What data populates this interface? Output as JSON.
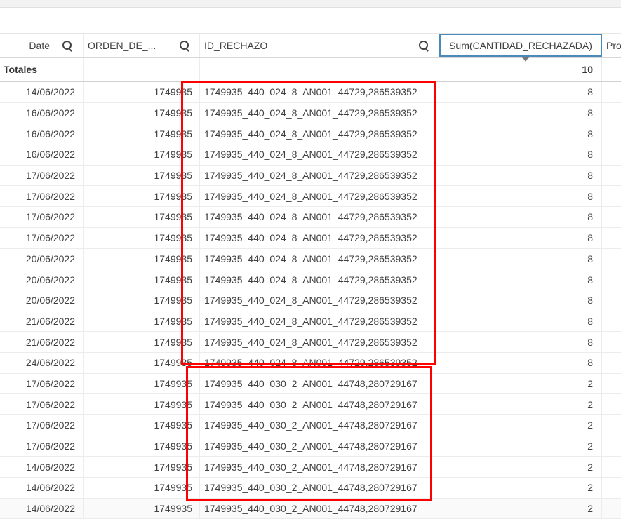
{
  "columns": {
    "date": "Date",
    "orden": "ORDEN_DE_...",
    "id": "ID_RECHAZO",
    "sum": "Sum(CANTIDAD_RECHAZADA)",
    "next": "Pro"
  },
  "totals": {
    "label": "Totales",
    "sum": "10"
  },
  "rows": [
    [
      "14/06/2022",
      "1749935",
      "1749935_440_024_8_AN001_44729,286539352",
      "8"
    ],
    [
      "16/06/2022",
      "1749935",
      "1749935_440_024_8_AN001_44729,286539352",
      "8"
    ],
    [
      "16/06/2022",
      "1749935",
      "1749935_440_024_8_AN001_44729,286539352",
      "8"
    ],
    [
      "16/06/2022",
      "1749935",
      "1749935_440_024_8_AN001_44729,286539352",
      "8"
    ],
    [
      "17/06/2022",
      "1749935",
      "1749935_440_024_8_AN001_44729,286539352",
      "8"
    ],
    [
      "17/06/2022",
      "1749935",
      "1749935_440_024_8_AN001_44729,286539352",
      "8"
    ],
    [
      "17/06/2022",
      "1749935",
      "1749935_440_024_8_AN001_44729,286539352",
      "8"
    ],
    [
      "17/06/2022",
      "1749935",
      "1749935_440_024_8_AN001_44729,286539352",
      "8"
    ],
    [
      "20/06/2022",
      "1749935",
      "1749935_440_024_8_AN001_44729,286539352",
      "8"
    ],
    [
      "20/06/2022",
      "1749935",
      "1749935_440_024_8_AN001_44729,286539352",
      "8"
    ],
    [
      "20/06/2022",
      "1749935",
      "1749935_440_024_8_AN001_44729,286539352",
      "8"
    ],
    [
      "21/06/2022",
      "1749935",
      "1749935_440_024_8_AN001_44729,286539352",
      "8"
    ],
    [
      "21/06/2022",
      "1749935",
      "1749935_440_024_8_AN001_44729,286539352",
      "8"
    ],
    [
      "24/06/2022",
      "1749935",
      "1749935_440_024_8_AN001_44729,286539352",
      "8"
    ],
    [
      "17/06/2022",
      "1749935",
      "1749935_440_030_2_AN001_44748,280729167",
      "2"
    ],
    [
      "17/06/2022",
      "1749935",
      "1749935_440_030_2_AN001_44748,280729167",
      "2"
    ],
    [
      "17/06/2022",
      "1749935",
      "1749935_440_030_2_AN001_44748,280729167",
      "2"
    ],
    [
      "17/06/2022",
      "1749935",
      "1749935_440_030_2_AN001_44748,280729167",
      "2"
    ],
    [
      "14/06/2022",
      "1749935",
      "1749935_440_030_2_AN001_44748,280729167",
      "2"
    ],
    [
      "14/06/2022",
      "1749935",
      "1749935_440_030_2_AN001_44748,280729167",
      "2"
    ],
    [
      "14/06/2022",
      "1749935",
      "1749935_440_030_2_AN001_44748,280729167",
      "2"
    ]
  ]
}
